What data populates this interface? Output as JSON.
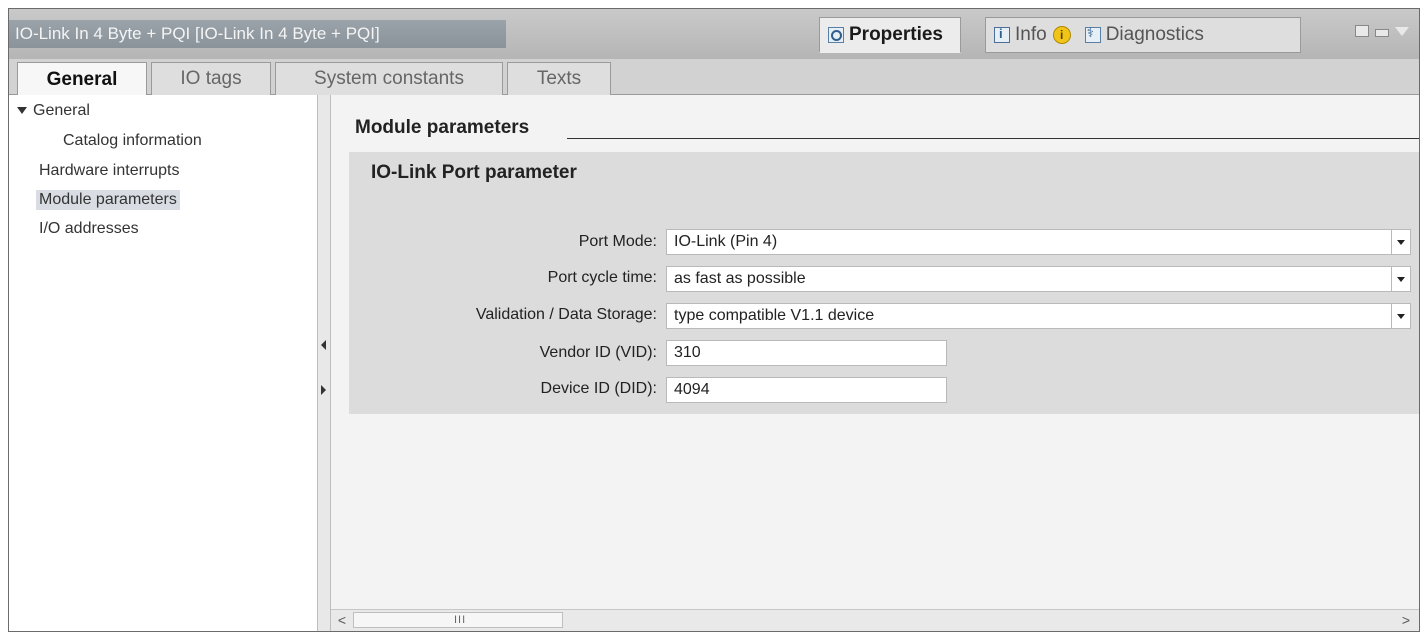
{
  "window": {
    "title": "IO-Link In  4 Byte + PQI [IO-Link In  4 Byte + PQI]",
    "right_tabs": {
      "properties": "Properties",
      "info": "Info",
      "diagnostics": "Diagnostics"
    },
    "icons": [
      "magnifier-icon",
      "info-icon",
      "warning-icon",
      "diagnostics-icon",
      "float-icon",
      "minimize-icon",
      "chevron-down-icon"
    ]
  },
  "tabs": [
    {
      "label": "General",
      "active": true
    },
    {
      "label": "IO tags",
      "active": false
    },
    {
      "label": "System constants",
      "active": false
    },
    {
      "label": "Texts",
      "active": false
    }
  ],
  "nav": {
    "general": "General",
    "catalog": "Catalog information",
    "hardware_interrupts": "Hardware interrupts",
    "module_parameters": "Module parameters",
    "io_addresses": "I/O addresses",
    "selected": "Module parameters"
  },
  "main": {
    "section_title": "Module parameters",
    "group_title": "IO-Link Port parameter",
    "params": {
      "port_mode": {
        "label": "Port Mode:",
        "value": "IO-Link (Pin 4)"
      },
      "cycle_time": {
        "label": "Port cycle time:",
        "value": "as fast as possible"
      },
      "validation": {
        "label": "Validation / Data Storage:",
        "value": "type compatible V1.1 device"
      },
      "vendor_id": {
        "label": "Vendor ID (VID):",
        "value": "310"
      },
      "device_id": {
        "label": "Device ID (DID):",
        "value": "4094"
      }
    }
  },
  "scrollbar": {
    "grip": "III",
    "left": "<",
    "right": ">"
  }
}
